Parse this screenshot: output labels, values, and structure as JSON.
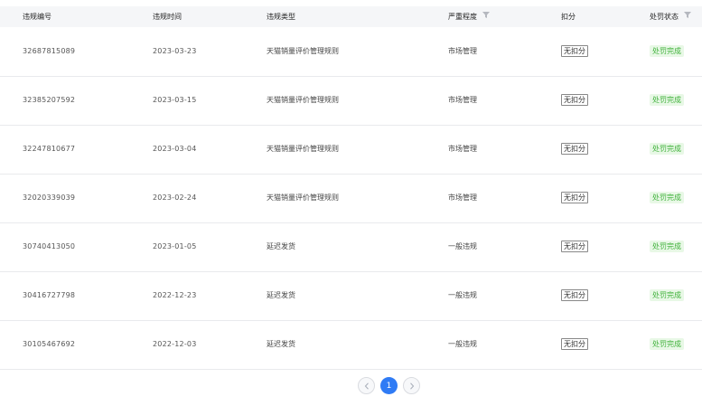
{
  "table": {
    "columns": {
      "id": "违规编号",
      "time": "违规时间",
      "type": "违规类型",
      "severity": "严重程度",
      "deduct": "扣分",
      "status": "处罚状态"
    },
    "rows": [
      {
        "id": "32687815089",
        "time": "2023-03-23",
        "type": "天猫销量评价管理规则",
        "severity": "市场管理",
        "deduct": "无扣分",
        "status": "处罚完成"
      },
      {
        "id": "32385207592",
        "time": "2023-03-15",
        "type": "天猫销量评价管理规则",
        "severity": "市场管理",
        "deduct": "无扣分",
        "status": "处罚完成"
      },
      {
        "id": "32247810677",
        "time": "2023-03-04",
        "type": "天猫销量评价管理规则",
        "severity": "市场管理",
        "deduct": "无扣分",
        "status": "处罚完成"
      },
      {
        "id": "32020339039",
        "time": "2023-02-24",
        "type": "天猫销量评价管理规则",
        "severity": "市场管理",
        "deduct": "无扣分",
        "status": "处罚完成"
      },
      {
        "id": "30740413050",
        "time": "2023-01-05",
        "type": "延迟发货",
        "severity": "一般违规",
        "deduct": "无扣分",
        "status": "处罚完成"
      },
      {
        "id": "30416727798",
        "time": "2022-12-23",
        "type": "延迟发货",
        "severity": "一般违规",
        "deduct": "无扣分",
        "status": "处罚完成"
      },
      {
        "id": "30105467692",
        "time": "2022-12-03",
        "type": "延迟发货",
        "severity": "一般违规",
        "deduct": "无扣分",
        "status": "处罚完成"
      }
    ]
  },
  "pagination": {
    "current": "1"
  },
  "icons": {
    "filter": "filter-icon",
    "prev": "chevron-left-icon",
    "next": "chevron-right-icon"
  },
  "colors": {
    "accent": "#2f7bf5",
    "status_bg": "#e8f8e6",
    "status_text": "#3fb13a",
    "header_bg": "#f5f6f8"
  }
}
